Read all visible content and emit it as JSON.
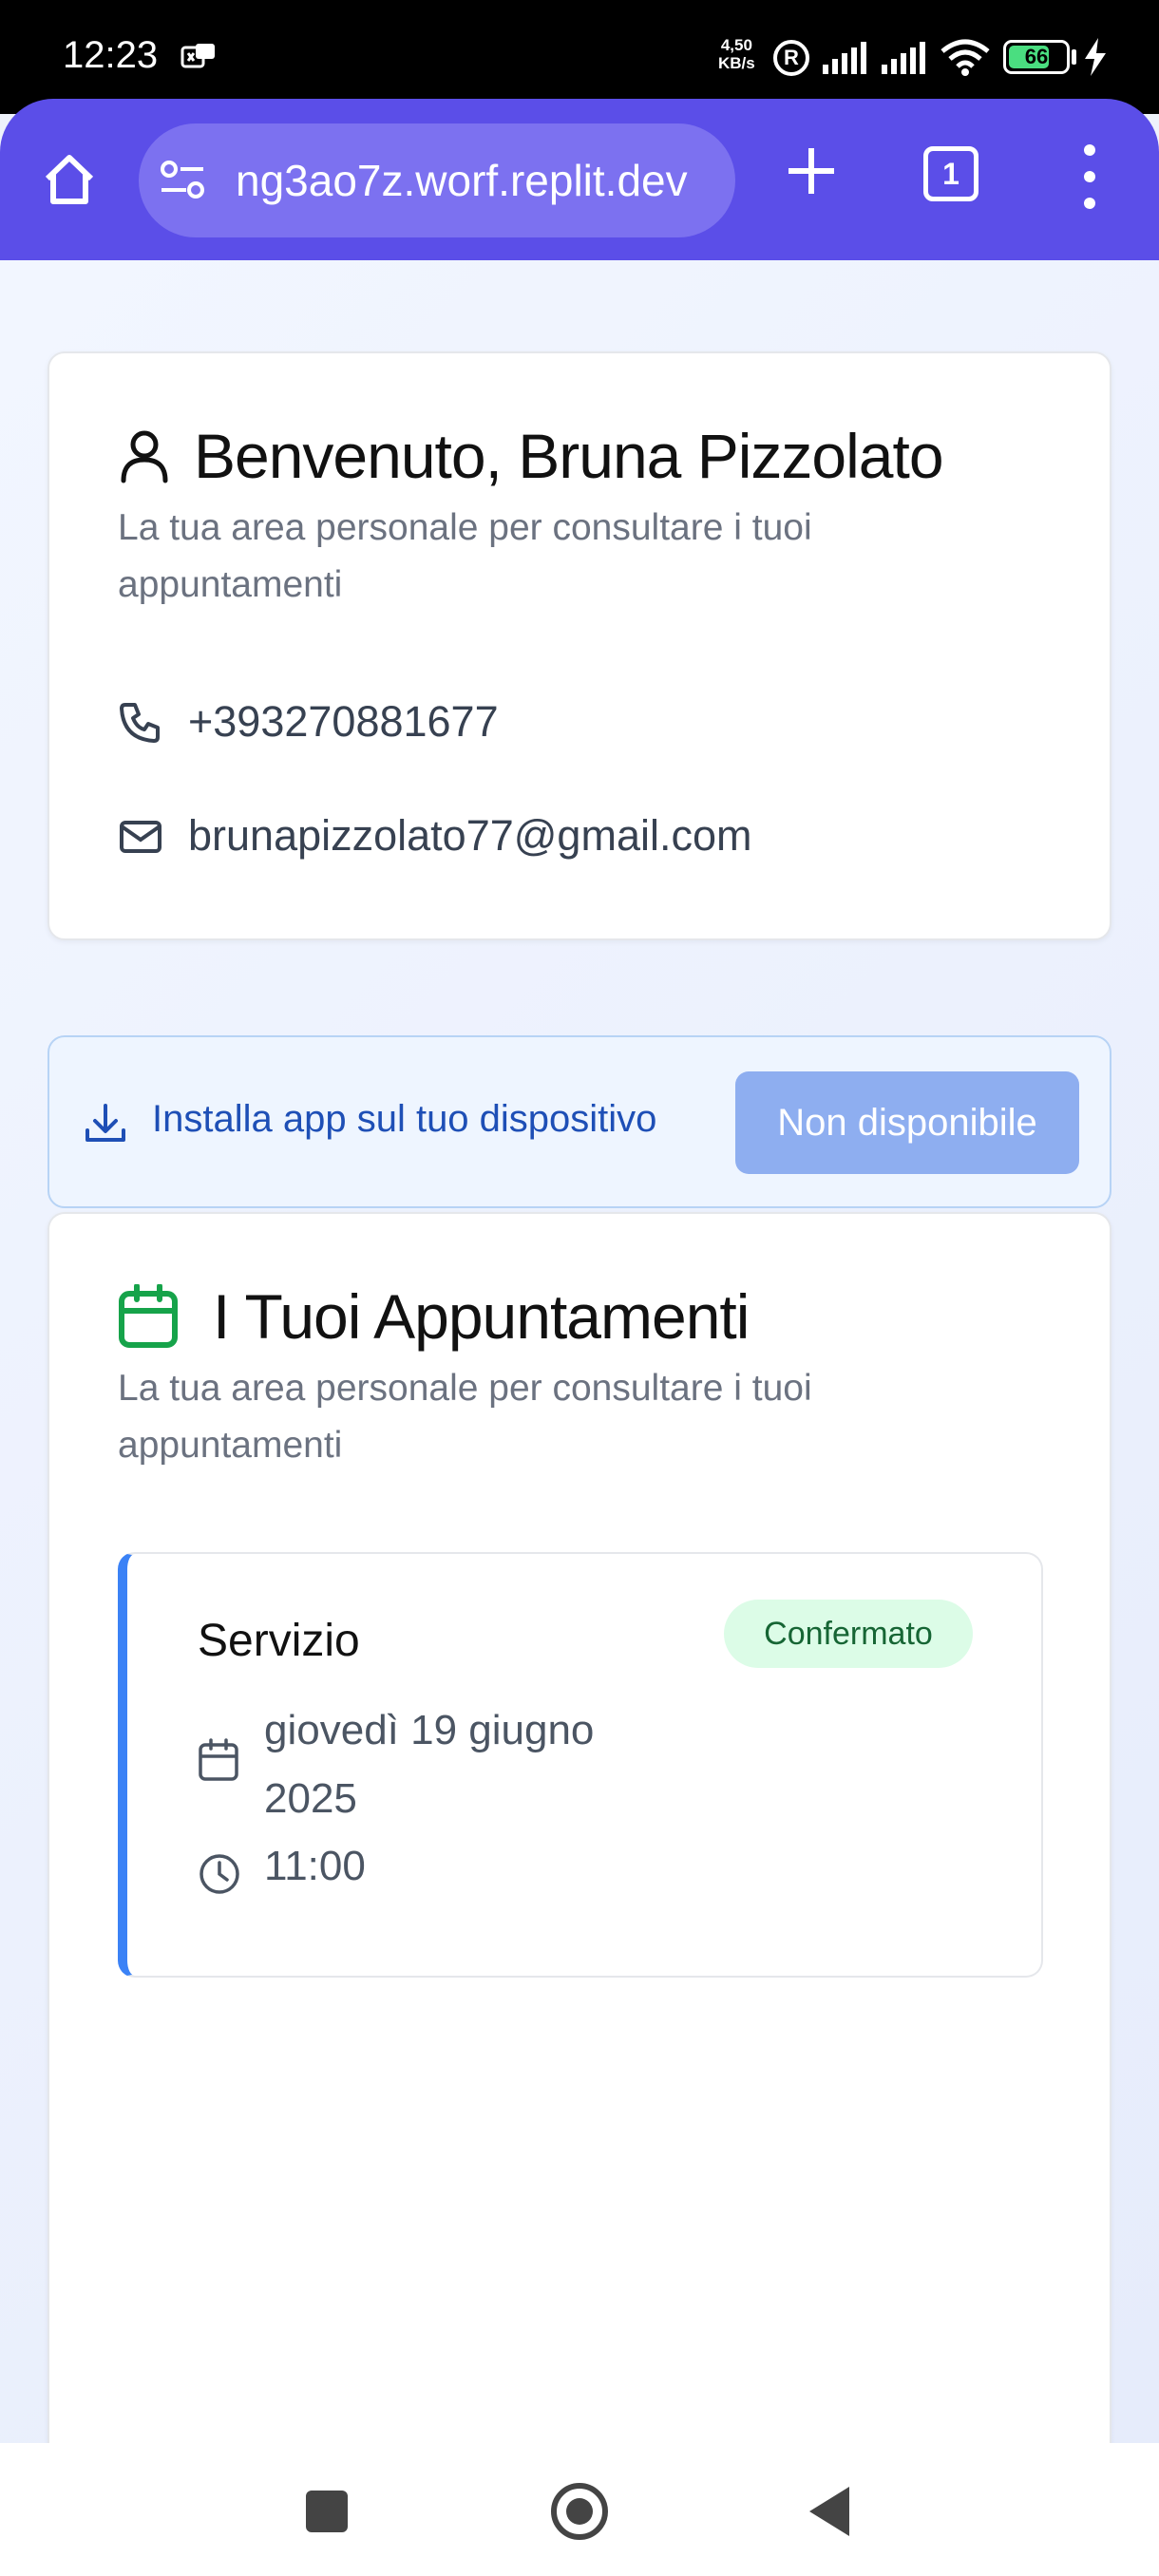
{
  "status_bar": {
    "time": "12:23",
    "net_speed_value": "4,50",
    "net_speed_unit": "KB/s",
    "r_icon_label": "R",
    "battery": "66"
  },
  "browser": {
    "url": "ng3ao7z.worf.replit.dev",
    "tab_count": "1"
  },
  "profile": {
    "title": "Benvenuto, Bruna Pizzolato",
    "subtitle": "La tua area personale per consultare i tuoi appuntamenti",
    "phone": "+393270881677",
    "email": "brunapizzolato77@gmail.com"
  },
  "install": {
    "label": "Installa app sul tuo dispositivo",
    "button": "Non disponibile"
  },
  "appointments": {
    "title": "I Tuoi Appuntamenti",
    "subtitle": "La tua area personale per consultare i tuoi appuntamenti",
    "items": [
      {
        "service": "Servizio",
        "status": "Confermato",
        "date": "giovedì 19 giugno 2025",
        "time": "11:00"
      }
    ]
  },
  "colors": {
    "browser_bar": "#5b4ee8",
    "accent_blue": "#3b82f6",
    "calendar_green": "#16a34a",
    "badge_green_bg": "#dcfce7"
  },
  "icons": {
    "browser": [
      "home-icon",
      "site-settings-icon",
      "plus-icon",
      "tab-switcher-icon",
      "more-vert-icon"
    ],
    "profile": [
      "user-icon",
      "phone-icon",
      "mail-icon"
    ],
    "install": "download-icon",
    "appointments": [
      "calendar-icon",
      "calendar-small-icon",
      "clock-icon"
    ]
  }
}
